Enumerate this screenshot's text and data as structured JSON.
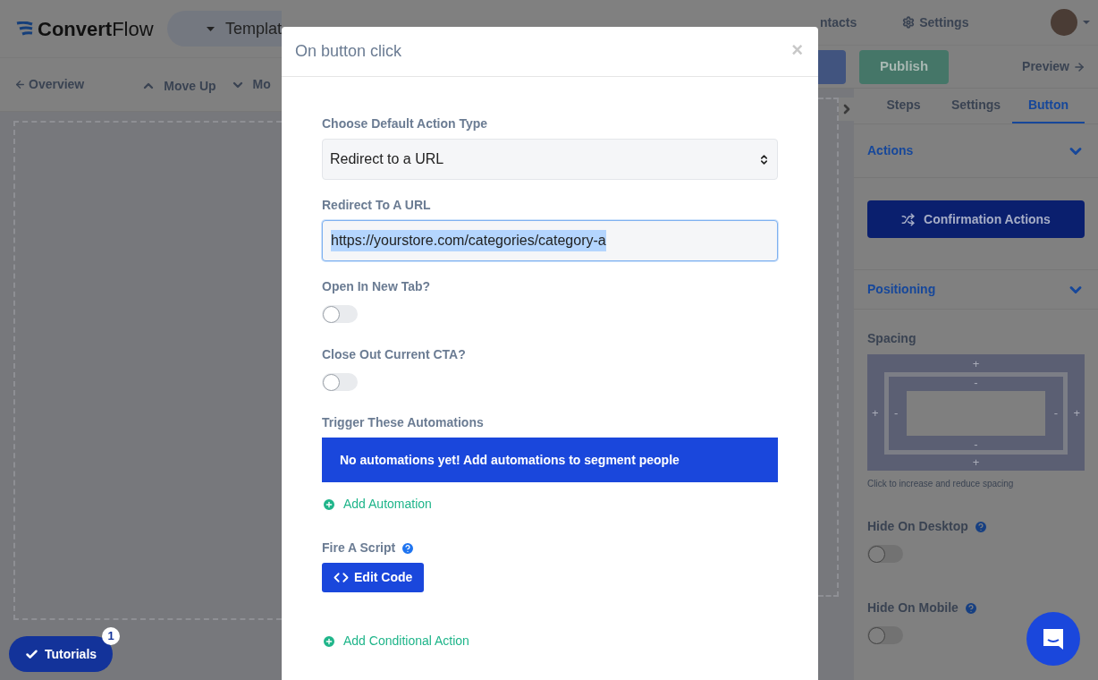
{
  "header": {
    "logo": "**Convert**Flow",
    "template_menu": "Templat",
    "nav": [
      {
        "label": "ntacts"
      },
      {
        "label": "Settings"
      }
    ]
  },
  "toolbar": {
    "overview": "Overview",
    "move_up": "Move Up",
    "move_down": "Mo",
    "publish": "Publish",
    "preview": "Preview"
  },
  "tutorials": {
    "label": "Tutorials",
    "badge": "1"
  },
  "dialog": {
    "title": "On button click",
    "close": "×",
    "fields": [
      {
        "kind": "select",
        "label": "Choose Default Action Type",
        "value": "Redirect to a URL"
      },
      {
        "kind": "text",
        "label": "Redirect To A URL",
        "value": "https://yourstore.com/categories/category-a",
        "highlighted": true
      },
      {
        "kind": "toggle",
        "label": "Open In New Tab?",
        "on": false
      },
      {
        "kind": "toggle",
        "label": "Close Out Current CTA?",
        "on": false
      },
      {
        "kind": "notice",
        "label": "Trigger These Automations",
        "notice": "No automations yet! Add automations to segment people",
        "link": "Add Automation"
      },
      {
        "kind": "script",
        "label": "Fire A Script",
        "button": "Edit Code"
      }
    ],
    "add_conditional": "Add Conditional Action"
  },
  "sidebar": {
    "tabs": [
      {
        "label": "Steps",
        "selected": false
      },
      {
        "label": "Settings",
        "selected": false
      },
      {
        "label": "Button",
        "selected": true
      }
    ],
    "actions": {
      "title": "Actions",
      "expanded": true,
      "button": "Confirmation Actions"
    },
    "positioning": {
      "title": "Positioning",
      "expanded": true,
      "spacing_label": "Spacing",
      "margin_controls": [
        "+",
        "+",
        "+",
        "+"
      ],
      "padding_controls": [
        "-",
        "-",
        "-",
        "-"
      ],
      "caption": "Click to increase and reduce spacing"
    },
    "visibility": [
      {
        "label": "Hide On Desktop",
        "on": false
      },
      {
        "label": "Hide On Mobile",
        "on": false
      }
    ]
  }
}
